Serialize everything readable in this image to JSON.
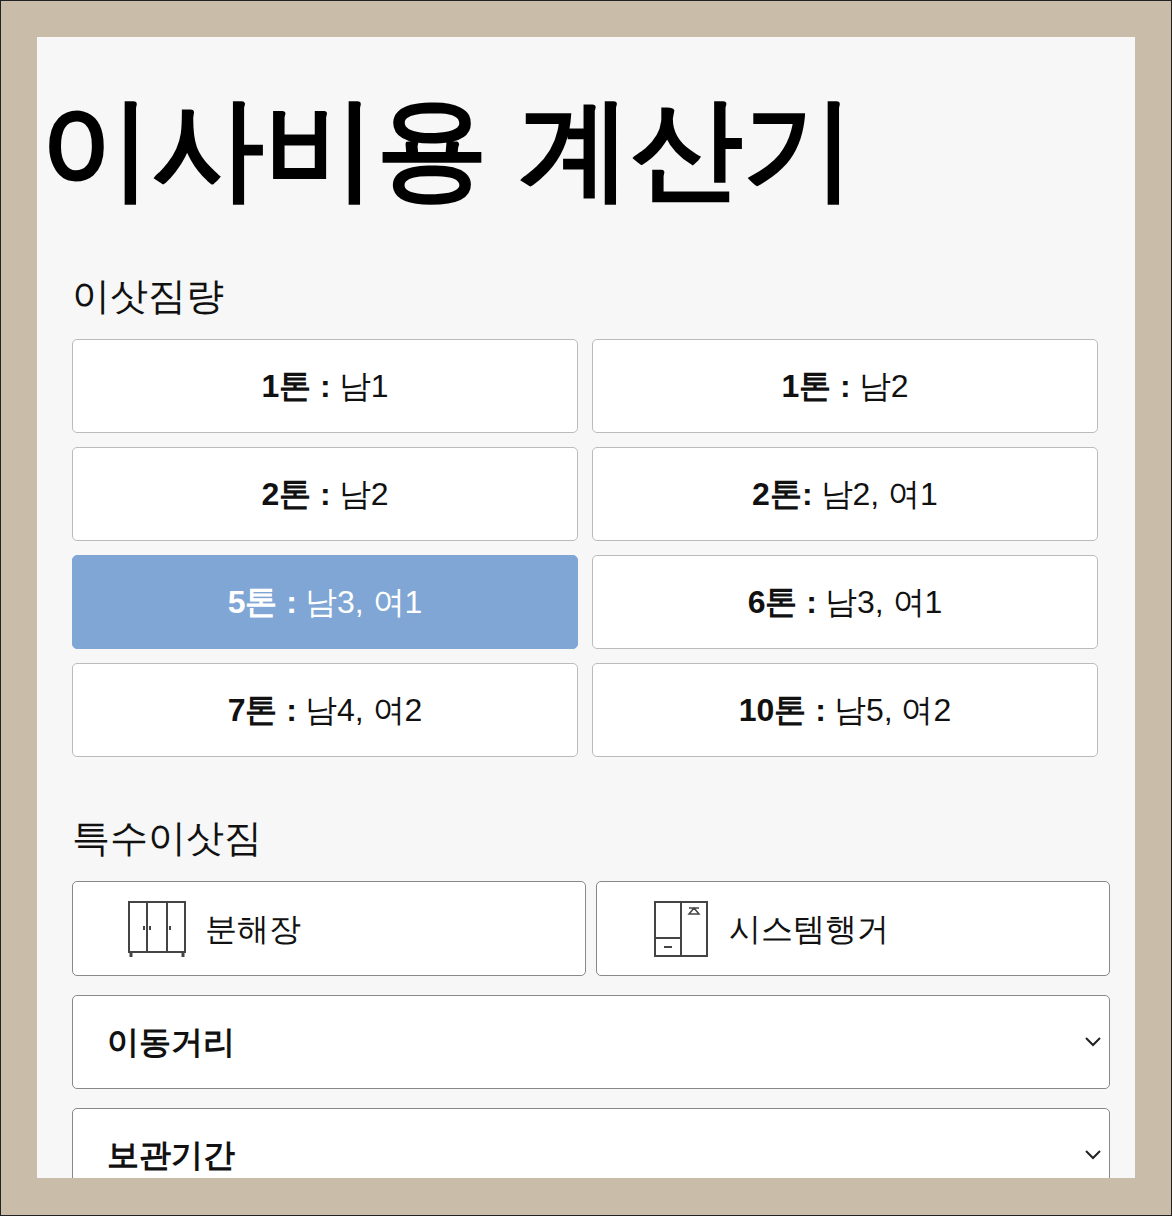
{
  "title": "이사비용 계산기",
  "load": {
    "heading": "이삿짐량",
    "options": [
      {
        "ton": "1톤 :",
        "crew": "남1",
        "selected": false
      },
      {
        "ton": "1톤 :",
        "crew": "남2",
        "selected": false
      },
      {
        "ton": "2톤 :",
        "crew": "남2",
        "selected": false
      },
      {
        "ton": "2톤:",
        "crew": "남2, 여1",
        "selected": false
      },
      {
        "ton": "5톤 :",
        "crew": "남3, 여1",
        "selected": true
      },
      {
        "ton": "6톤 :",
        "crew": "남3, 여1",
        "selected": false
      },
      {
        "ton": "7톤 :",
        "crew": "남4, 여2",
        "selected": false
      },
      {
        "ton": "10톤 :",
        "crew": "남5, 여2",
        "selected": false
      }
    ]
  },
  "special": {
    "heading": "특수이삿짐",
    "items": [
      {
        "label": "분해장",
        "kind": "wardrobe"
      },
      {
        "label": "시스템행거",
        "kind": "hanger"
      }
    ]
  },
  "selects": [
    {
      "label": "이동거리"
    },
    {
      "label": "보관기간"
    }
  ]
}
